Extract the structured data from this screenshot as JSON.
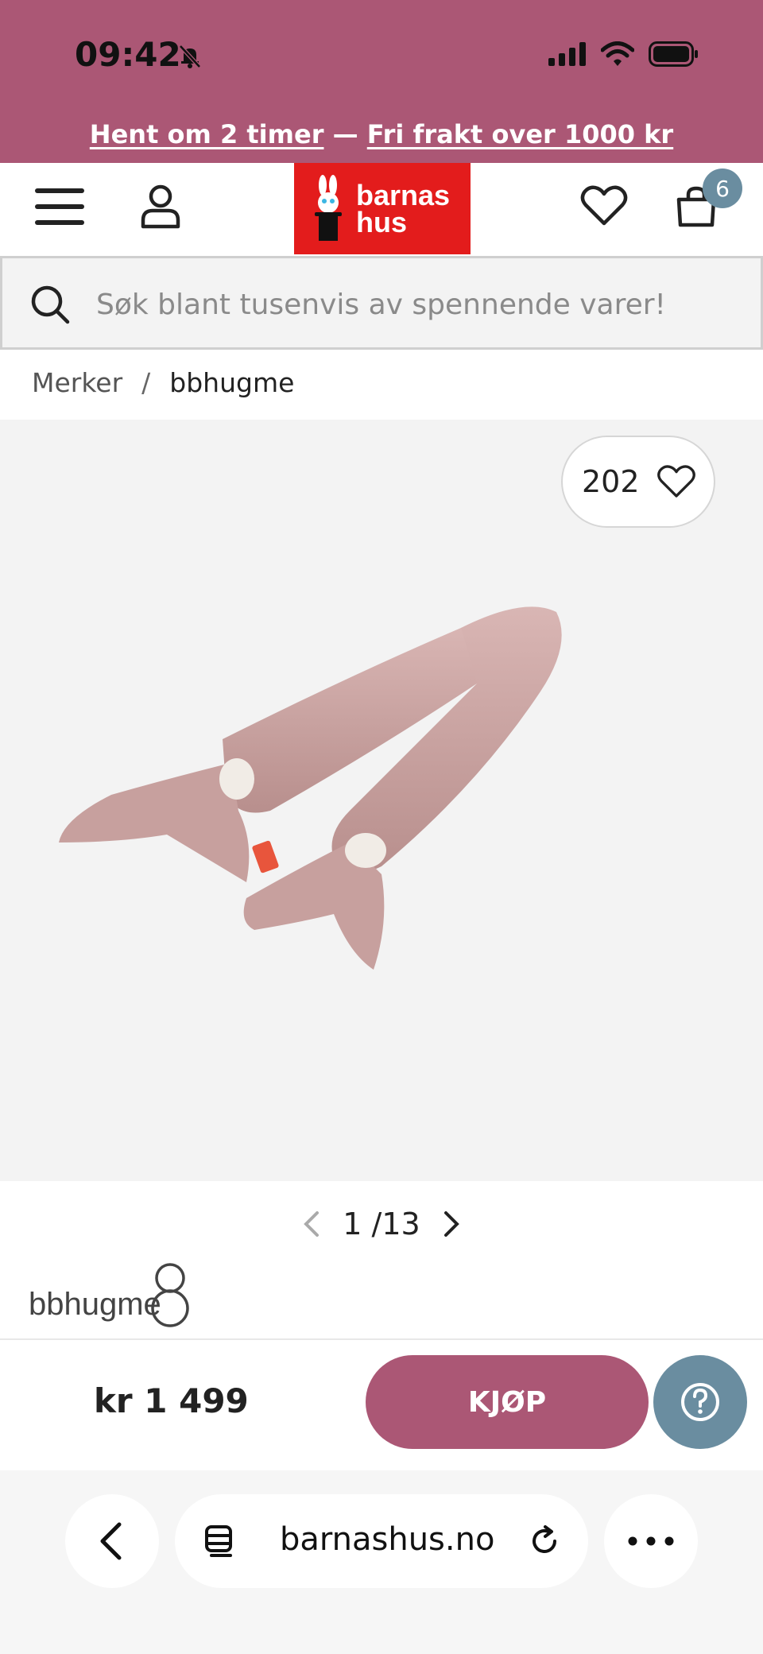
{
  "status_bar": {
    "time": "09:42"
  },
  "promo": {
    "part1": "Hent om 2 timer",
    "separator": " — ",
    "part2": "Fri frakt over 1000 kr"
  },
  "header": {
    "logo_line1": "barnas",
    "logo_line2": "hus",
    "cart_count": "6"
  },
  "search": {
    "placeholder": "Søk blant tusenvis av spennende varer!"
  },
  "breadcrumb": {
    "items": [
      "Merker",
      "bbhugme"
    ],
    "separator": "/"
  },
  "product": {
    "favorites": "202",
    "image_index": "1",
    "image_separator": "/",
    "image_total": "13",
    "brand_logo_text": "bbhugme",
    "price": "kr 1 499",
    "buy_label": "KJØP"
  },
  "browser": {
    "url": "barnashus.no"
  },
  "colors": {
    "accent": "#ab5775",
    "help": "#6a8da0",
    "logo": "#e31c1c"
  }
}
